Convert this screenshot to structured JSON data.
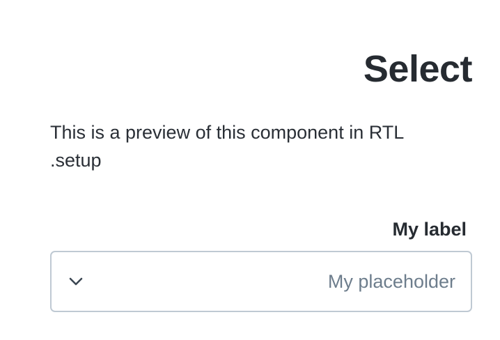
{
  "heading": {
    "title": "Select"
  },
  "description": {
    "line1": "This is a preview of this component in RTL",
    "line2": ".setup"
  },
  "select": {
    "label": "My label",
    "placeholder": "My placeholder",
    "icon": "chevron-down-icon",
    "border_color": "#bfc9d3",
    "placeholder_color": "#6d7d8c"
  }
}
